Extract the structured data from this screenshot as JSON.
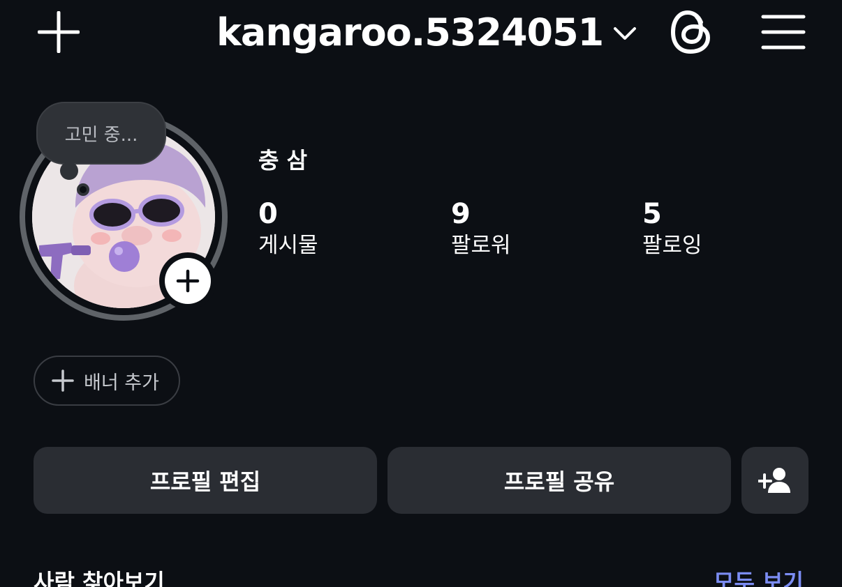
{
  "header": {
    "username": "kangaroo.5324051"
  },
  "profile": {
    "note": "고민 중...",
    "display_name": "충 삼",
    "stats": [
      {
        "value": "0",
        "label": "게시물"
      },
      {
        "value": "9",
        "label": "팔로워"
      },
      {
        "value": "5",
        "label": "팔로잉"
      }
    ]
  },
  "banner": {
    "label": "배너 추가"
  },
  "actions": {
    "edit_label": "프로필 편집",
    "share_label": "프로필 공유"
  },
  "suggestions": {
    "title": "사람 찾아보기",
    "see_all": "모두 보기"
  },
  "colors": {
    "background": "#0c0f14",
    "button": "#2a2d33",
    "link": "#7b8cf2",
    "ring": "#5f6368"
  },
  "icons": {
    "create": "plus-icon",
    "account_switch": "chevron-down-icon",
    "threads": "threads-icon",
    "menu": "hamburger-menu-icon",
    "add_story": "plus-icon",
    "add_banner": "plus-icon",
    "discover": "add-person-icon"
  }
}
